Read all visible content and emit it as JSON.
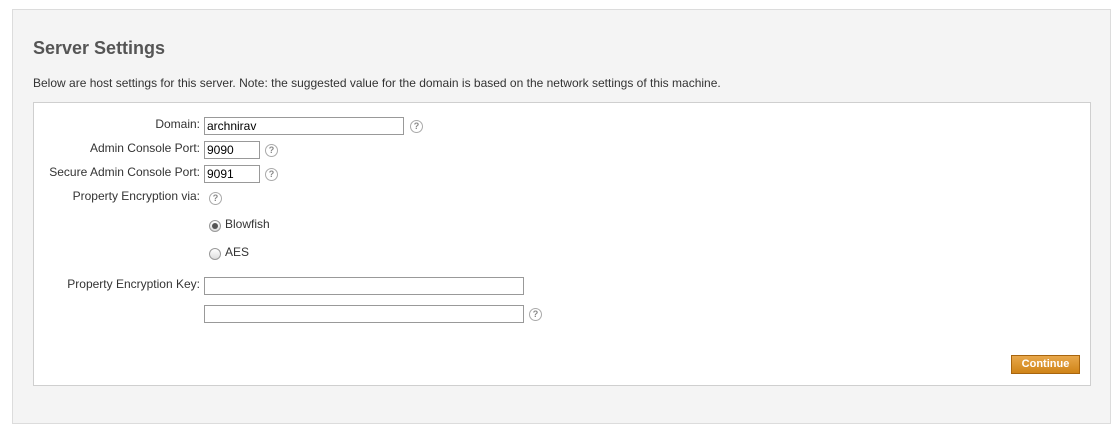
{
  "page": {
    "title": "Server Settings",
    "description": "Below are host settings for this server. Note: the suggested value for the domain is based on the network settings of this machine."
  },
  "form": {
    "domain_label": "Domain:",
    "domain_value": "archnirav",
    "admin_port_label": "Admin Console Port:",
    "admin_port_value": "9090",
    "secure_port_label": "Secure Admin Console Port:",
    "secure_port_value": "9091",
    "encryption_label": "Property Encryption via:",
    "encryption_options": [
      {
        "label": "Blowfish",
        "selected": true
      },
      {
        "label": "AES",
        "selected": false
      }
    ],
    "encryption_key_label": "Property Encryption Key:",
    "encryption_key_value": "",
    "encryption_key_confirm_value": "",
    "help_glyph": "?",
    "continue_label": "Continue"
  },
  "colors": {
    "button_bg": "#d68d24",
    "panel_bg": "#f4f4f4"
  }
}
